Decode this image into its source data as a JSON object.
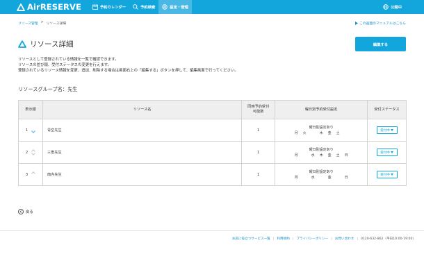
{
  "header": {
    "logo_text": "AirRESERVE",
    "nav": [
      {
        "label": "予約カレンダー",
        "icon": "calendar-icon"
      },
      {
        "label": "予約検索",
        "icon": "search-icon"
      },
      {
        "label": "設定・管理",
        "icon": "gear-icon",
        "active": true
      }
    ],
    "publish_label": "公開中",
    "accent": "#12a6dc"
  },
  "breadcrumb": {
    "items": [
      "リソース管理",
      "リソース詳細"
    ],
    "separator": ">"
  },
  "manual_link": "この画面のマニュアルはこちら",
  "page_title": "リソース詳細",
  "edit_button": "編集する",
  "description": [
    "リソースとして登録されている情報を一覧で確認できます。",
    "リソースの並び順、受付ステータスの変更を行えます。",
    "登録されているリソース情報を変更、追加、削除する場合は画面右上の「編集する」ボタンを押して、編集画面で行ってください。"
  ],
  "group_label": "リソースグループ名：先生",
  "table": {
    "headers": {
      "order": "表示順",
      "name": "リソース名",
      "concurrent_line1": "同時予約受付",
      "concurrent_line2": "可能数",
      "weekday": "曜日別予約受付設定",
      "status": "受付ステータス"
    },
    "rows": [
      {
        "order": "1",
        "name": "青空先生",
        "concurrent": "1",
        "weekday_note": "曜日別設定あり",
        "days": [
          "月",
          "火",
          "",
          "木",
          "金",
          "土",
          ""
        ],
        "status": "受付中"
      },
      {
        "order": "2",
        "name": "三角先生",
        "concurrent": "1",
        "weekday_note": "曜日別設定あり",
        "days": [
          "月",
          "",
          "水",
          "木",
          "金",
          "土",
          "日"
        ],
        "status": "受付中"
      },
      {
        "order": "3",
        "name": "南内先生",
        "concurrent": "1",
        "weekday_note": "曜日別設定あり",
        "days": [
          "月",
          "",
          "水",
          "",
          "金",
          "",
          "日"
        ],
        "status": "受付中"
      }
    ]
  },
  "back_label": "戻る",
  "footer": {
    "links": [
      "お店に役立つサービス一覧",
      "利用規約",
      "プライバシーポリシー",
      "お問い合わせ"
    ],
    "phone": "0120-632-862（平日10:00-19:00）"
  }
}
